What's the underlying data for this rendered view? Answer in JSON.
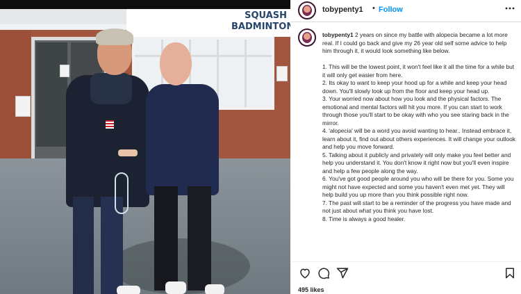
{
  "photo": {
    "sign_lines": [
      "SQUASH",
      "BADMINTON"
    ]
  },
  "post": {
    "username": "tobypenty1",
    "separator": "•",
    "follow_label": "Follow",
    "more_icon": "more-options-icon",
    "caption_lead": "2 years on since my battle with alopecia became a lot more real. If I could go back and give my 26 year old self some advice to help him through it, it would look something like below.",
    "caption_items": [
      "1. This will be the lowest point, it won't feel like it all the time for a while but it will only get easier from here.",
      "2. Its okay to want to keep your hood up for a while and keep your head down. You'll slowly look up from the floor and keep your head up.",
      "3. Your worried now about how you look and the physical factors. The emotional and mental factors will hit you more. If you can start to work through those you'll start to be okay with who you see staring back in the mirror.",
      "4. 'alopecia' will be a word you avoid wanting to hear.. Instead embrace it, learn about it, find out about others experiences. It will change your outlook and help you move forward.",
      "5. Talking about it publicly and privately will only make you feel better and help you understand it. You don't know it right now but you'll even inspire and help a few people along the way.",
      "6. You've got good people around you who will be there for you. Some you might not have expected and some you haven't even met yet. They will help build you up more than you think possible right now.",
      "7. The past will start to be a reminder of the progress you have made and not just about what you think you have lost.",
      "8. Time is always a good healer."
    ],
    "actions": {
      "like_icon": "heart-icon",
      "comment_icon": "comment-icon",
      "share_icon": "share-icon",
      "save_icon": "bookmark-icon"
    },
    "likes": "495 likes"
  },
  "colors": {
    "follow": "#0095f6",
    "text": "#262626",
    "sign": "#27456b"
  }
}
